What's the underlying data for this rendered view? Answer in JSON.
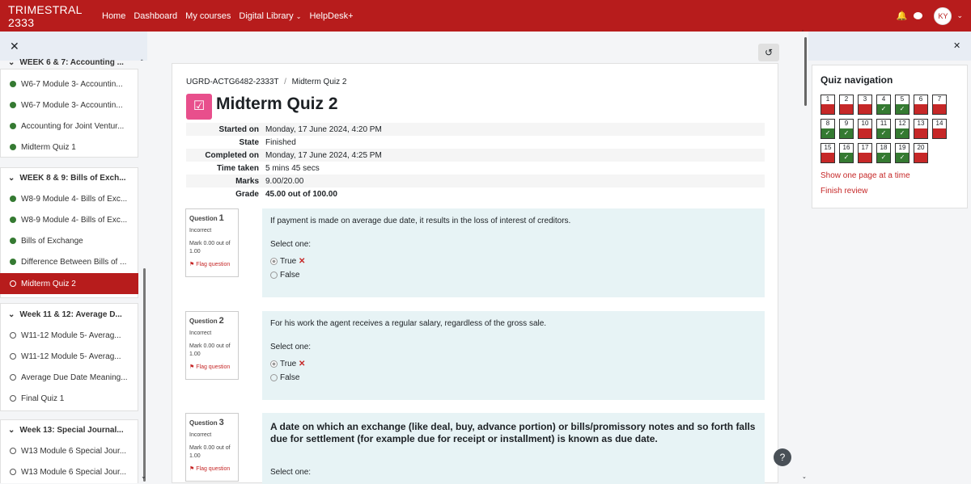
{
  "header": {
    "brand": "TRIMESTRAL 2333",
    "links": [
      "Home",
      "Dashboard",
      "My courses",
      "Digital Library",
      "HelpDesk+"
    ],
    "avatar": "KY"
  },
  "sidebar": {
    "top_partial": "WEEK 6 & 7: Accounting ...",
    "s1_items": [
      "W6-7 Module 3- Accountin...",
      "W6-7 Module 3- Accountin...",
      "Accounting for Joint Ventur...",
      "Midterm Quiz 1"
    ],
    "s2_title": "WEEK 8 & 9: Bills of Exch...",
    "s2_items": [
      "W8-9 Module 4- Bills of Exc...",
      "W8-9 Module 4- Bills of Exc...",
      "Bills of Exchange",
      "Difference Between Bills of ...",
      "Midterm Quiz 2"
    ],
    "s3_title": "Week 11 & 12: Average D...",
    "s3_items": [
      "W11-12 Module 5- Averag...",
      "W11-12 Module 5- Averag...",
      "Average Due Date Meaning...",
      "Final Quiz 1"
    ],
    "s4_title": "Week 13: Special Journal...",
    "s4_items": [
      "W13 Module 6 Special Jour...",
      "W13 Module 6 Special Jour..."
    ]
  },
  "main": {
    "breadcrumb": [
      "UGRD-ACTG6482-2333T",
      "Midterm Quiz 2"
    ],
    "title": "Midterm Quiz 2",
    "summary": [
      [
        "Started on",
        "Monday, 17 June 2024, 4:20 PM"
      ],
      [
        "State",
        "Finished"
      ],
      [
        "Completed on",
        "Monday, 17 June 2024, 4:25 PM"
      ],
      [
        "Time taken",
        "5 mins 45 secs"
      ],
      [
        "Marks",
        "9.00/20.00"
      ],
      [
        "Grade",
        "45.00 out of 100.00"
      ]
    ],
    "questions": [
      {
        "label": "Question",
        "num": "1",
        "status": "Incorrect",
        "mark": "Mark 0.00 out of 1.00",
        "flag": "Flag question",
        "text": "If payment is made on average due date, it results in the loss of interest of creditors.",
        "select": "Select one:",
        "opt1": "True",
        "opt2": "False"
      },
      {
        "label": "Question",
        "num": "2",
        "status": "Incorrect",
        "mark": "Mark 0.00 out of 1.00",
        "flag": "Flag question",
        "text": "For his work the agent receives a regular salary, regardless of the gross sale.",
        "select": "Select one:",
        "opt1": "True",
        "opt2": "False"
      },
      {
        "label": "Question",
        "num": "3",
        "status": "Incorrect",
        "mark": "Mark 0.00 out of 1.00",
        "flag": "Flag question",
        "text": "A date on which an exchange (like deal, buy, advance portion) or bills/promissory notes and so forth falls due for settlement (for example due for receipt or installment) is known as due date.",
        "select": "Select one:"
      }
    ]
  },
  "quiznav": {
    "title": "Quiz navigation",
    "buttons": [
      {
        "n": "1",
        "ok": false
      },
      {
        "n": "2",
        "ok": false
      },
      {
        "n": "3",
        "ok": false
      },
      {
        "n": "4",
        "ok": true
      },
      {
        "n": "5",
        "ok": true
      },
      {
        "n": "6",
        "ok": false
      },
      {
        "n": "7",
        "ok": false
      },
      {
        "n": "8",
        "ok": true
      },
      {
        "n": "9",
        "ok": true
      },
      {
        "n": "10",
        "ok": false
      },
      {
        "n": "11",
        "ok": true
      },
      {
        "n": "12",
        "ok": true
      },
      {
        "n": "13",
        "ok": false
      },
      {
        "n": "14",
        "ok": false
      },
      {
        "n": "15",
        "ok": false
      },
      {
        "n": "16",
        "ok": true
      },
      {
        "n": "17",
        "ok": false
      },
      {
        "n": "18",
        "ok": true
      },
      {
        "n": "19",
        "ok": true
      },
      {
        "n": "20",
        "ok": false
      }
    ],
    "show_one": "Show one page at a time",
    "finish": "Finish review"
  },
  "help": "?"
}
